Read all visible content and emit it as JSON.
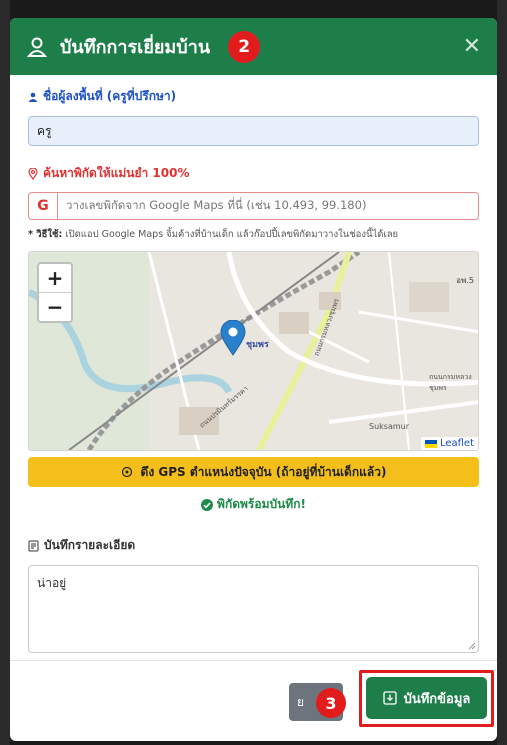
{
  "modal": {
    "title": "บันทึกการเยี่ยมบ้าน",
    "step_badge": "2",
    "close_icon": "close-icon"
  },
  "area_user": {
    "label": "ชื่อผู้ลงพื้นที่ (ครูที่ปรึกษา)",
    "value": "ครู"
  },
  "coordinates": {
    "label": "ค้นหาพิกัดให้แม่นยำ 100%",
    "google_icon": "G",
    "placeholder": "วางเลขพิกัดจาก Google Maps ที่นี่ (เช่น 10.493, 99.180)",
    "hint_prefix": "* วิธีใช้:",
    "hint_text": " เปิดแอป Google Maps จิ้มค้างที่บ้านเด็ก แล้วก๊อปปี้เลขพิกัดมาวางในช่องนี้ได้เลย"
  },
  "map": {
    "zoom_in": "+",
    "zoom_out": "−",
    "attribution": "Leaflet",
    "place_label": "ชุมพร",
    "road_label": "ถนนปรมินทร์มรรคา",
    "road_label_2": "ถนนกรมหลวงชุมพร",
    "corner_label": "อพ.5",
    "road_label_3": "Suksamur",
    "road_label_4": "ถนนกรมหลวงชุมพร"
  },
  "gps": {
    "button_label": "ดึง GPS ตำแหน่งปัจจุบัน (ถ้าอยู่ที่บ้านเด็กแล้ว)",
    "ready_text": "พิกัดพร้อมบันทึก!"
  },
  "details": {
    "label": "บันทึกรายละเอียด",
    "value": "น่าอยู่"
  },
  "footer": {
    "cancel_label": "ย",
    "step_badge": "3",
    "save_label": "บันทึกข้อมูล"
  },
  "colors": {
    "header": "#1e7e4a",
    "badge": "#e21c1c",
    "gps_button": "#f4bf1a",
    "label_blue": "#1e52c4",
    "label_red": "#e03131"
  }
}
